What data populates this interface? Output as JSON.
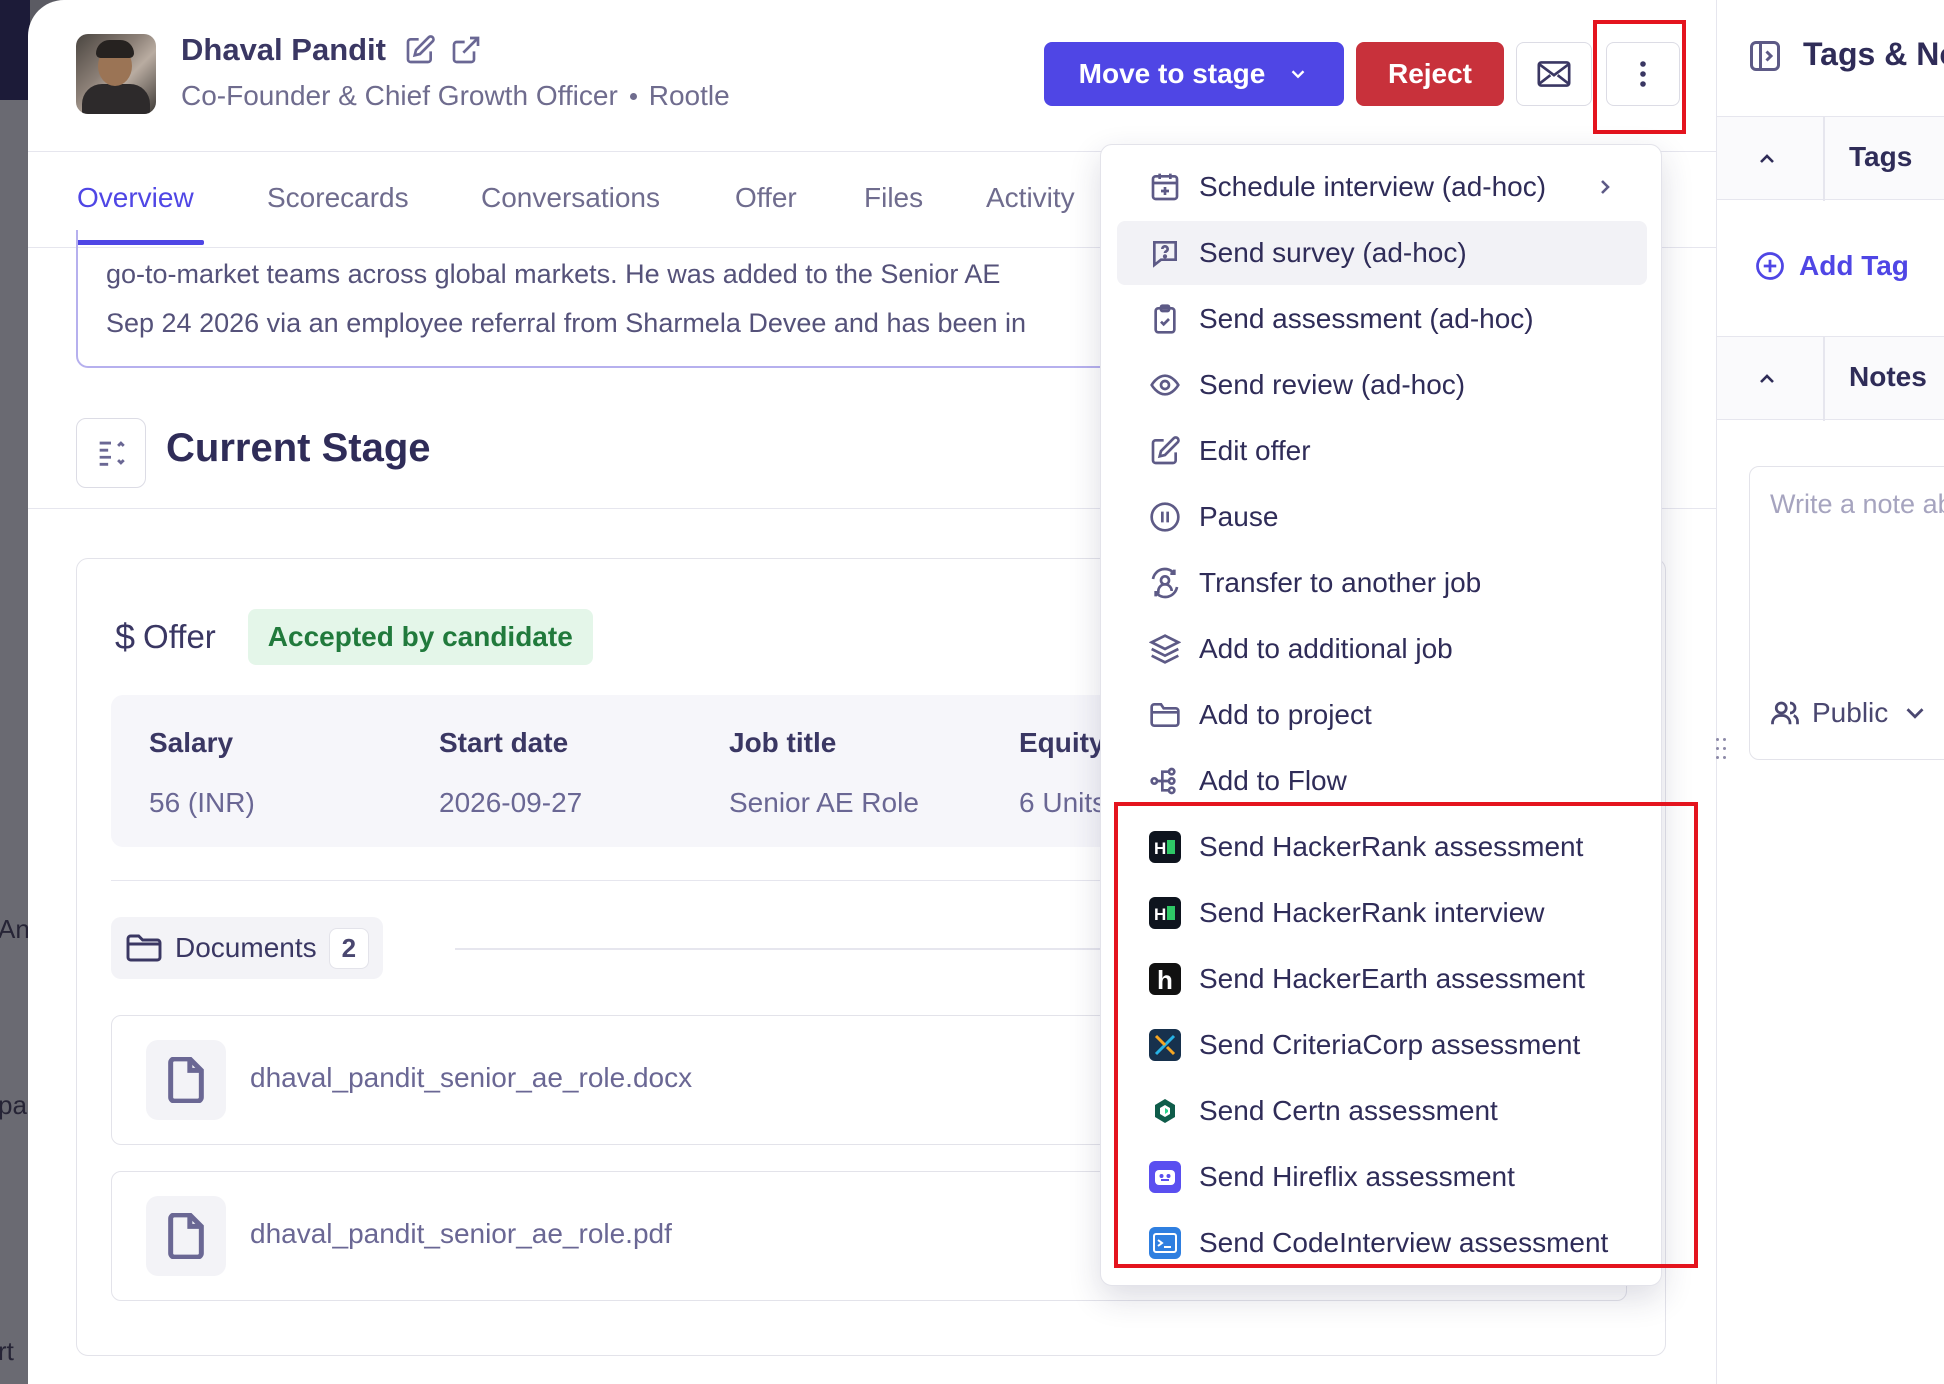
{
  "background": {
    "fragments": [
      "An",
      "pa",
      "rt"
    ]
  },
  "candidate": {
    "name": "Dhaval Pandit",
    "role": "Co-Founder & Chief Growth Officer",
    "company": "Rootle"
  },
  "actions": {
    "move_to_stage": "Move to stage",
    "reject": "Reject"
  },
  "tabs": [
    "Overview",
    "Scorecards",
    "Conversations",
    "Offer",
    "Files",
    "Activity"
  ],
  "active_tab": "Overview",
  "summary": {
    "line1": "go-to-market teams across global markets. He was added to the Senior AE",
    "line2": "Sep 24 2026 via an employee referral from Sharmela Devee and has been in"
  },
  "current_stage": {
    "title": "Current Stage"
  },
  "offer": {
    "label": "Offer",
    "status": "Accepted by candidate",
    "columns": [
      {
        "header": "Salary",
        "value": "56 (INR)"
      },
      {
        "header": "Start date",
        "value": "2026-09-27"
      },
      {
        "header": "Job title",
        "value": "Senior AE Role"
      },
      {
        "header": "Equity",
        "value": "6 Units"
      }
    ]
  },
  "documents": {
    "label": "Documents",
    "count": "2",
    "files": [
      "dhaval_pandit_senior_ae_role.docx",
      "dhaval_pandit_senior_ae_role.pdf"
    ]
  },
  "right_panel": {
    "title": "Tags & Notes",
    "tags_label": "Tags",
    "add_tag": "Add Tag",
    "notes_label": "Notes",
    "note_placeholder": "Write a note about...",
    "visibility": "Public"
  },
  "menu": {
    "items": [
      {
        "label": "Schedule interview (ad-hoc)",
        "icon": "calendar-plus-icon",
        "submenu": true
      },
      {
        "label": "Send survey (ad-hoc)",
        "icon": "survey-icon",
        "hovered": true
      },
      {
        "label": "Send assessment (ad-hoc)",
        "icon": "clipboard-check-icon"
      },
      {
        "label": "Send review (ad-hoc)",
        "icon": "eye-icon"
      },
      {
        "label": "Edit offer",
        "icon": "edit-icon"
      },
      {
        "label": "Pause",
        "icon": "pause-icon"
      },
      {
        "label": "Transfer to another job",
        "icon": "transfer-icon"
      },
      {
        "label": "Add to additional job",
        "icon": "layers-icon"
      },
      {
        "label": "Add to project",
        "icon": "folder-icon"
      },
      {
        "label": "Add to Flow",
        "icon": "flow-icon"
      },
      {
        "label": "Send HackerRank assessment",
        "icon": "hackerrank-logo"
      },
      {
        "label": "Send HackerRank interview",
        "icon": "hackerrank-logo"
      },
      {
        "label": "Send HackerEarth assessment",
        "icon": "hackerearth-logo"
      },
      {
        "label": "Send CriteriaCorp assessment",
        "icon": "criteriacorp-logo"
      },
      {
        "label": "Send Certn assessment",
        "icon": "certn-logo"
      },
      {
        "label": "Send Hireflix assessment",
        "icon": "hireflix-logo"
      },
      {
        "label": "Send CodeInterview assessment",
        "icon": "codeinterview-logo"
      }
    ]
  },
  "colors": {
    "primary": "#4f46e5",
    "reject": "#c8313b",
    "success_bg": "#e4f6e9",
    "success_text": "#217a3c",
    "highlight": "#e4141e"
  }
}
